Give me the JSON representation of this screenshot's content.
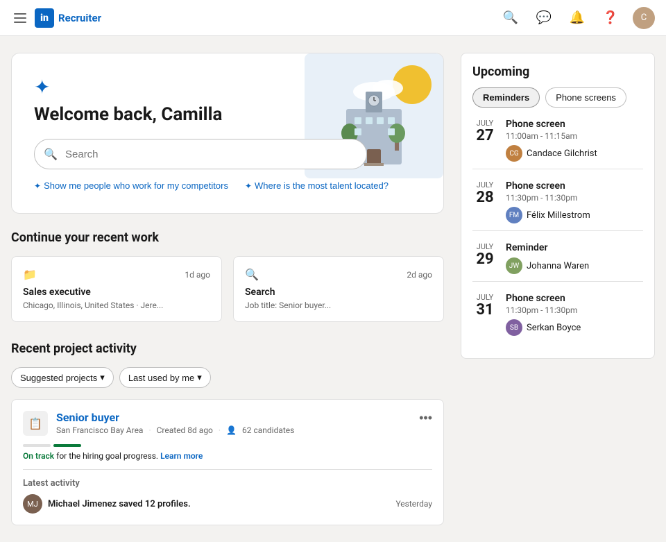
{
  "navbar": {
    "logo_text": "Recruiter",
    "li_letter": "in"
  },
  "hero": {
    "greeting": "Welcome back, Camilla",
    "search_placeholder": "Search",
    "suggestion1": "Show me people who work for my competitors",
    "suggestion2": "Where is the most talent located?"
  },
  "recent_work": {
    "section_title": "Continue your recent work",
    "cards": [
      {
        "icon": "📁",
        "time": "1d ago",
        "title": "Sales executive",
        "subtitle": "Chicago, Illinois, United States · Jere..."
      },
      {
        "icon": "🔍",
        "time": "2d ago",
        "title": "Search",
        "subtitle": "Job title: Senior buyer..."
      }
    ]
  },
  "project_activity": {
    "section_title": "Recent project activity",
    "filter_suggested": "Suggested projects",
    "filter_last_used": "Last used by me",
    "project": {
      "title": "Senior buyer",
      "location": "San Francisco Bay Area",
      "created": "Created 8d ago",
      "candidates": "62 candidates",
      "progress_label": "On track",
      "progress_text": "for the hiring goal progress.",
      "learn_more": "Learn more",
      "latest_activity_label": "Latest activity",
      "activity_person": "Michael Jimenez saved 12 profiles.",
      "activity_time": "Yesterday"
    }
  },
  "upcoming": {
    "title": "Upcoming",
    "tabs": [
      "Reminders",
      "Phone screens"
    ],
    "events": [
      {
        "month": "July",
        "day": "27",
        "type": "Phone screen",
        "time": "11:00am - 11:15am",
        "person": "Candace Gilchrist",
        "avatar_color": "#c08040"
      },
      {
        "month": "July",
        "day": "28",
        "type": "Phone screen",
        "time": "11:30pm - 11:30pm",
        "person": "Félix Millestrom",
        "avatar_color": "#6080c0"
      },
      {
        "month": "July",
        "day": "29",
        "type": "Reminder",
        "time": "",
        "person": "Johanna Waren",
        "avatar_color": "#80a060"
      },
      {
        "month": "July",
        "day": "31",
        "type": "Phone screen",
        "time": "11:30pm - 11:30pm",
        "person": "Serkan Boyce",
        "avatar_color": "#8060a0"
      }
    ]
  },
  "icons": {
    "hamburger": "☰",
    "search": "🔍",
    "message": "💬",
    "bell": "🔔",
    "help": "❓",
    "more": "•••",
    "chevron_down": "▾",
    "star": "✦"
  }
}
